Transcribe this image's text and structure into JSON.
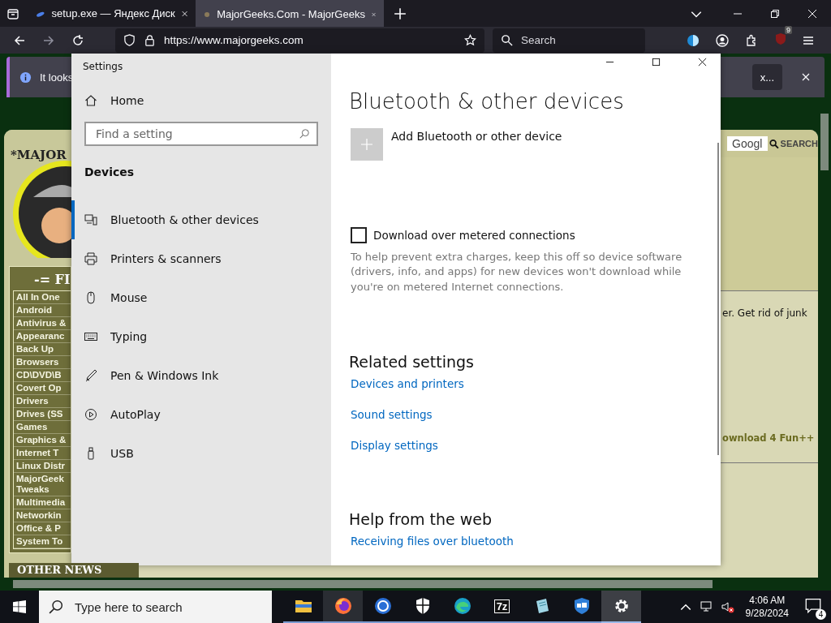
{
  "browser": {
    "tabs": [
      {
        "title": "setup.exe — Яндекс Диск",
        "selected": false
      },
      {
        "title": "MajorGeeks.Com - MajorGeeks",
        "selected": true
      }
    ],
    "url": "https://www.majorgeeks.com",
    "search": {
      "placeholder": "Search"
    },
    "extension_badge": "9",
    "notification": {
      "text": "It looks",
      "button": "x..."
    }
  },
  "website": {
    "logo_text": "*MAJOR",
    "menu_heading": "-= FI",
    "menu": [
      "All In One",
      "Android",
      "Antivirus &",
      "Appearanc",
      "Back Up",
      "Browsers",
      "CD\\DVD\\B",
      "Covert Op",
      "Drivers",
      "Drives (SS",
      "Games",
      "Graphics &",
      "Internet T",
      "Linux Distr",
      "MajorGeek\nTweaks",
      "Multimedia",
      "Networkin",
      "Office & P",
      "System To"
    ],
    "bottom_heading": "OTHER NEWS",
    "search_value": "Googl",
    "search_button": "SEARCH",
    "snippet": "er. Get rid of junk",
    "download_link": "ownload 4 Fun++"
  },
  "settings": {
    "title": "Settings",
    "home": "Home",
    "search": {
      "placeholder": "Find a setting"
    },
    "section": "Devices",
    "nav": [
      {
        "kind": "bluetooth",
        "label": "Bluetooth & other devices",
        "selected": true
      },
      {
        "kind": "printer",
        "label": "Printers & scanners",
        "selected": false
      },
      {
        "kind": "mouse",
        "label": "Mouse",
        "selected": false
      },
      {
        "kind": "keyboard",
        "label": "Typing",
        "selected": false
      },
      {
        "kind": "pen",
        "label": "Pen & Windows Ink",
        "selected": false
      },
      {
        "kind": "autoplay",
        "label": "AutoPlay",
        "selected": false
      },
      {
        "kind": "usb",
        "label": "USB",
        "selected": false
      }
    ],
    "heading": "Bluetooth & other devices",
    "add_device": "Add Bluetooth or other device",
    "metered": {
      "label": "Download over metered connections",
      "checked": false,
      "description": "To help prevent extra charges, keep this off so device software (drivers, info, and apps) for new devices won't download while you're on metered Internet connections."
    },
    "related_heading": "Related settings",
    "related_links": [
      "Devices and printers",
      "Sound settings",
      "Display settings"
    ],
    "help_heading": "Help from the web",
    "help_links": [
      "Receiving files over bluetooth"
    ]
  },
  "taskbar": {
    "search": {
      "placeholder": "Type here to search"
    },
    "apps": [
      {
        "kind": "folder",
        "active": false
      },
      {
        "kind": "firefox",
        "active": false,
        "open": true
      },
      {
        "kind": "ring",
        "active": false
      },
      {
        "kind": "shield",
        "active": false
      },
      {
        "kind": "edge",
        "active": false
      },
      {
        "kind": "archiver",
        "label": "7z",
        "active": false
      },
      {
        "kind": "notepad",
        "active": false
      },
      {
        "kind": "security",
        "active": false
      },
      {
        "kind": "gear",
        "active": true
      }
    ],
    "time": "4:06 AM",
    "date": "9/28/2024",
    "notifications": "4"
  }
}
